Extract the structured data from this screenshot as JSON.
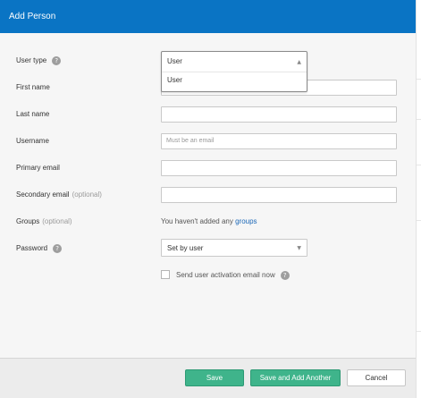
{
  "header": {
    "title": "Add Person"
  },
  "form": {
    "user_type": {
      "label": "User type",
      "selected": "User",
      "options": [
        "User"
      ]
    },
    "first_name": {
      "label": "First name",
      "value": ""
    },
    "last_name": {
      "label": "Last name",
      "value": ""
    },
    "username": {
      "label": "Username",
      "placeholder": "Must be an email"
    },
    "primary_email": {
      "label": "Primary email",
      "value": ""
    },
    "secondary_email": {
      "label": "Secondary email",
      "optional": "(optional)",
      "value": ""
    },
    "groups": {
      "label": "Groups",
      "optional": "(optional)",
      "text": "You haven't added any",
      "link": "groups"
    },
    "password": {
      "label": "Password",
      "selected": "Set by user"
    },
    "activation": {
      "label": "Send user activation email now",
      "checked": false
    },
    "help_glyph": "?"
  },
  "footer": {
    "save": "Save",
    "save_and_add": "Save and Add Another",
    "cancel": "Cancel"
  },
  "icons": {
    "select_arrow_up": "▲",
    "select_arrow_down": "▼"
  },
  "colors": {
    "header_bg": "#0a74c4",
    "primary_button": "#3fb48b",
    "link": "#1a67b7"
  }
}
